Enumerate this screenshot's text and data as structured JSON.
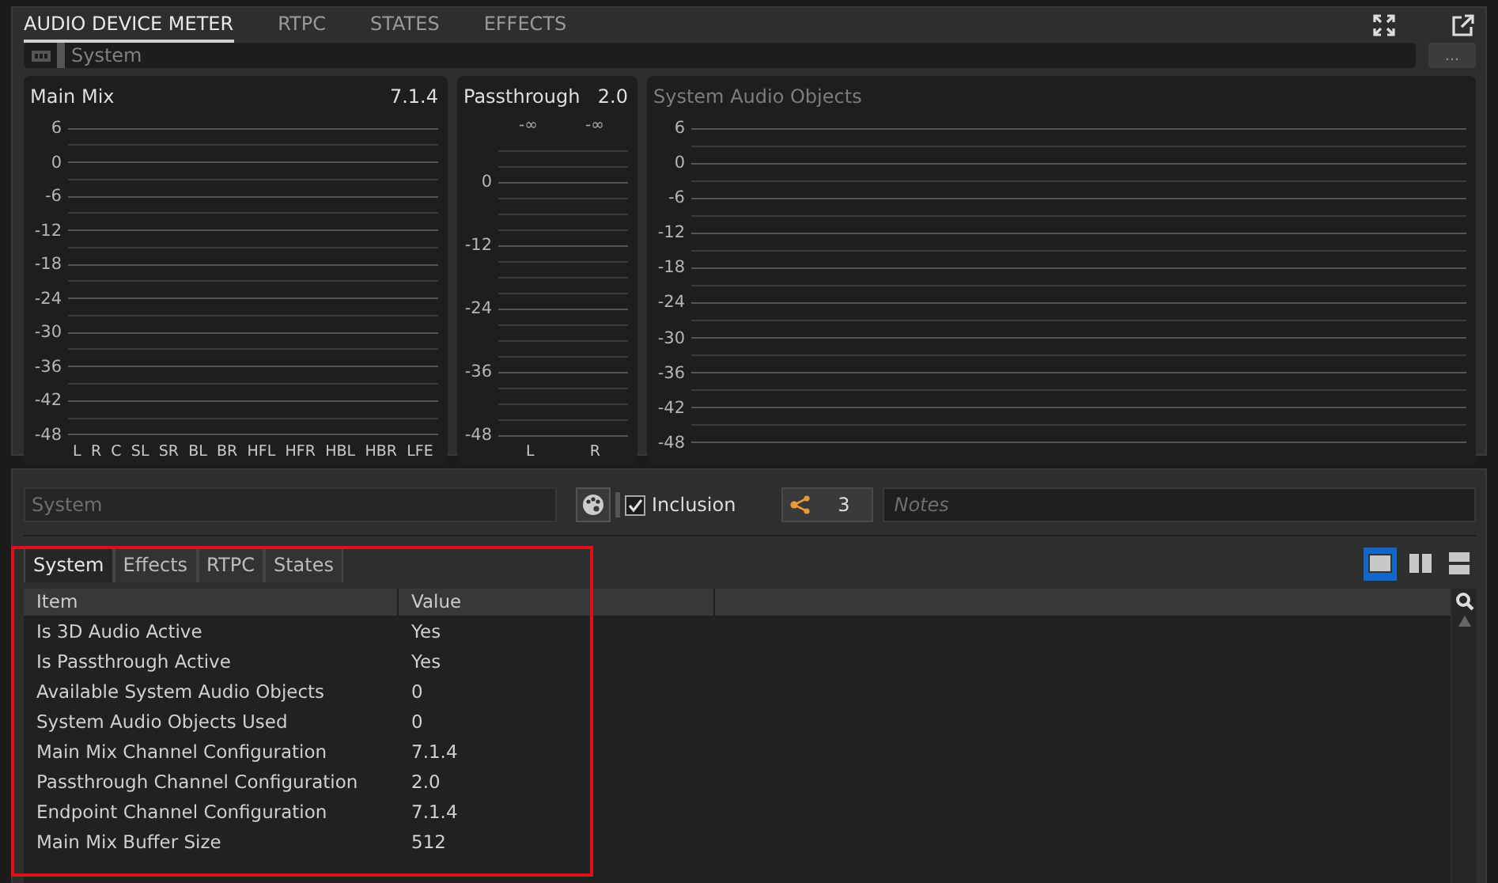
{
  "header_tabs": [
    {
      "label": "AUDIO DEVICE METER",
      "selected": true
    },
    {
      "label": "RTPC",
      "selected": false
    },
    {
      "label": "STATES",
      "selected": false
    },
    {
      "label": "EFFECTS",
      "selected": false
    }
  ],
  "device_field": {
    "value": "System",
    "more": "..."
  },
  "meters": [
    {
      "title": "Main Mix",
      "config": "7.1.4",
      "disabled": false,
      "scale": [
        "6",
        "0",
        "-6",
        "-12",
        "-18",
        "-24",
        "-30",
        "-36",
        "-42",
        "-48"
      ],
      "channels": [
        "L",
        "R",
        "C",
        "SL",
        "SR",
        "BL",
        "BR",
        "HFL",
        "HFR",
        "HBL",
        "HBR",
        "LFE"
      ]
    },
    {
      "title": "Passthrough",
      "config": "2.0",
      "disabled": false,
      "readings": [
        "-∞",
        "-∞"
      ],
      "scale": [
        "0",
        "-12",
        "-24",
        "-36",
        "-48"
      ],
      "channels": [
        "L",
        "R"
      ]
    },
    {
      "title": "System Audio Objects",
      "disabled": true,
      "scale": [
        "6",
        "0",
        "-6",
        "-12",
        "-18",
        "-24",
        "-30",
        "-36",
        "-42",
        "-48"
      ]
    }
  ],
  "name_field": {
    "placeholder": "System"
  },
  "inclusion": {
    "label": "Inclusion",
    "checked": true
  },
  "references": {
    "count": "3"
  },
  "notes": {
    "placeholder": "Notes"
  },
  "sub_tabs": [
    {
      "label": "System",
      "selected": true
    },
    {
      "label": "Effects",
      "selected": false
    },
    {
      "label": "RTPC",
      "selected": false
    },
    {
      "label": "States",
      "selected": false
    }
  ],
  "layout_buttons": [
    {
      "kind": "single",
      "selected": true
    },
    {
      "kind": "columns",
      "selected": false
    },
    {
      "kind": "rows",
      "selected": false
    }
  ],
  "table": {
    "columns": [
      "Item",
      "Value"
    ],
    "rows": [
      [
        "Is 3D Audio Active",
        "Yes"
      ],
      [
        "Is Passthrough Active",
        "Yes"
      ],
      [
        "Available System Audio Objects",
        "0"
      ],
      [
        "System Audio Objects Used",
        "0"
      ],
      [
        "Main Mix Channel Configuration",
        "7.1.4"
      ],
      [
        "Passthrough Channel Configuration",
        "2.0"
      ],
      [
        "Endpoint Channel Configuration",
        "7.1.4"
      ],
      [
        "Main Mix Buffer Size",
        "512"
      ]
    ]
  }
}
